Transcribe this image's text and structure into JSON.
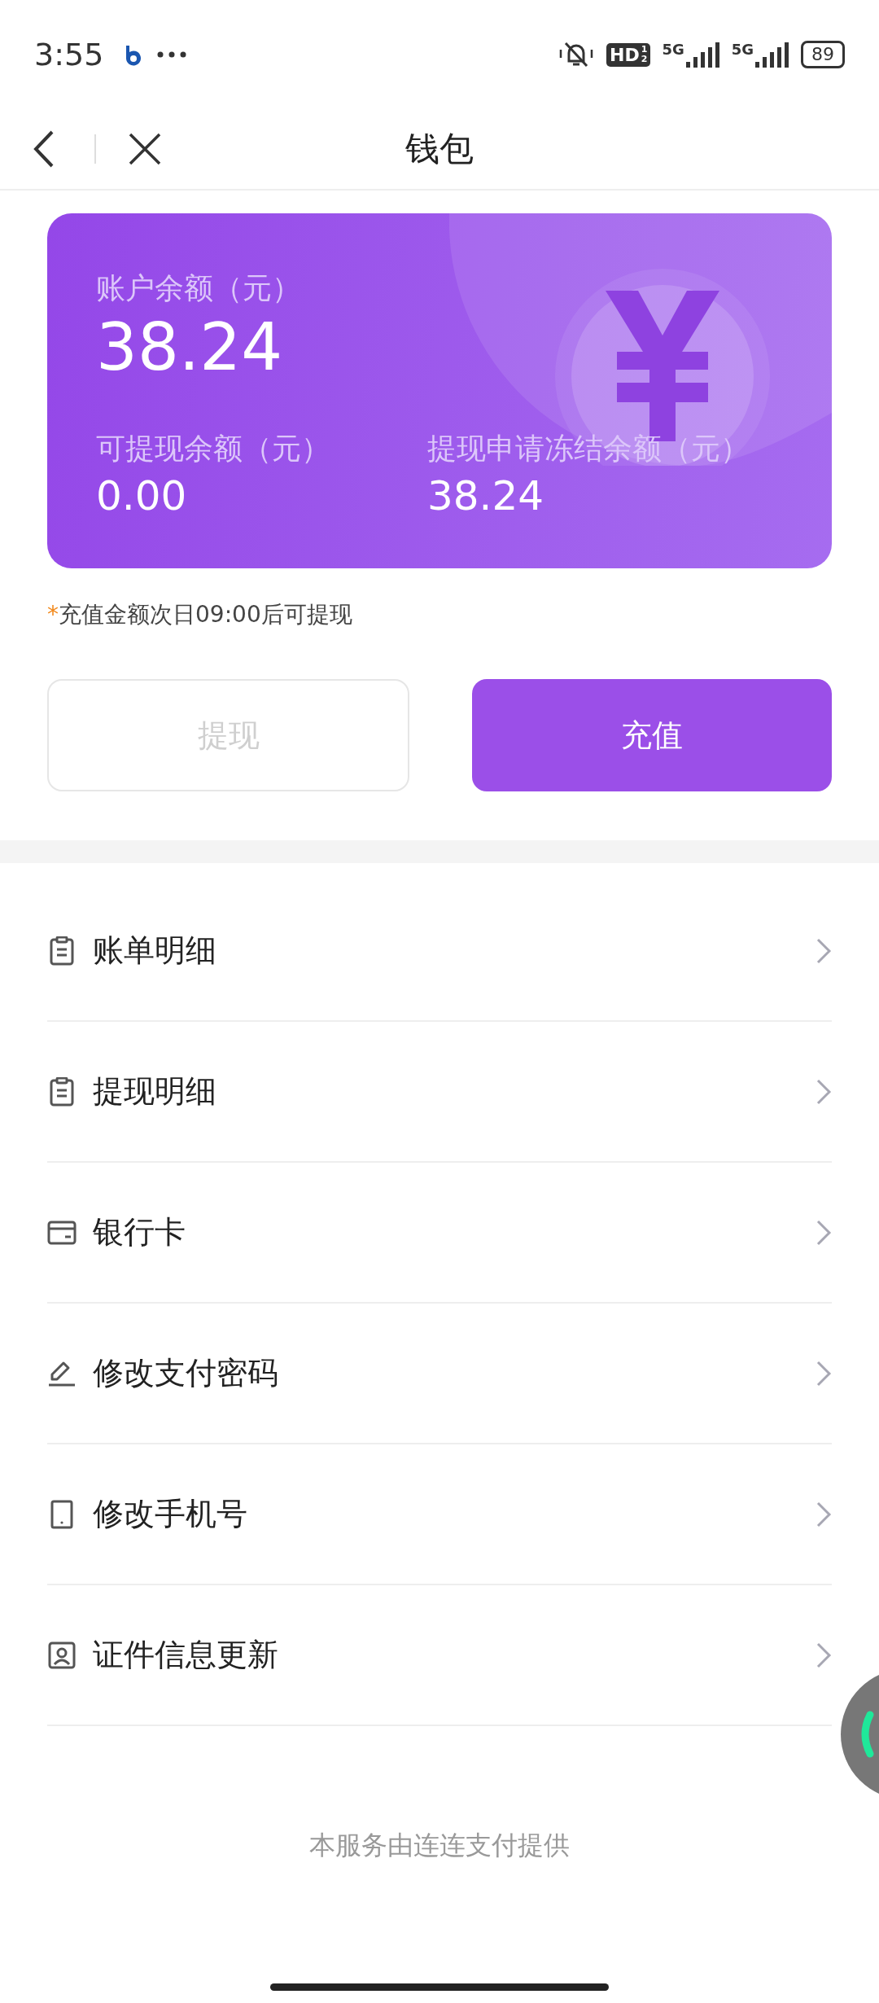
{
  "status_bar": {
    "time": "3:55",
    "hd_label": "HD",
    "hd_sims": [
      "1",
      "2"
    ],
    "networks": [
      "5G",
      "5G"
    ],
    "battery": "89"
  },
  "nav": {
    "title": "钱包"
  },
  "balance_card": {
    "label": "账户余额（元）",
    "amount": "38.24",
    "sub": [
      {
        "label": "可提现余额（元）",
        "amount": "0.00"
      },
      {
        "label": "提现申请冻结余额（元）",
        "amount": "38.24"
      }
    ]
  },
  "note": {
    "mark": "*",
    "text": "充值金额次日09:00后可提现"
  },
  "buttons": [
    {
      "label": "提现",
      "disabled": true
    },
    {
      "label": "充值",
      "disabled": false
    }
  ],
  "menu": [
    {
      "kind": "clipboard",
      "label": "账单明细"
    },
    {
      "kind": "clipboard",
      "label": "提现明细"
    },
    {
      "kind": "card",
      "label": "银行卡"
    },
    {
      "kind": "pen",
      "label": "修改支付密码"
    },
    {
      "kind": "phone",
      "label": "修改手机号"
    },
    {
      "kind": "id",
      "label": "证件信息更新"
    }
  ],
  "footer": "本服务由连连支付提供"
}
